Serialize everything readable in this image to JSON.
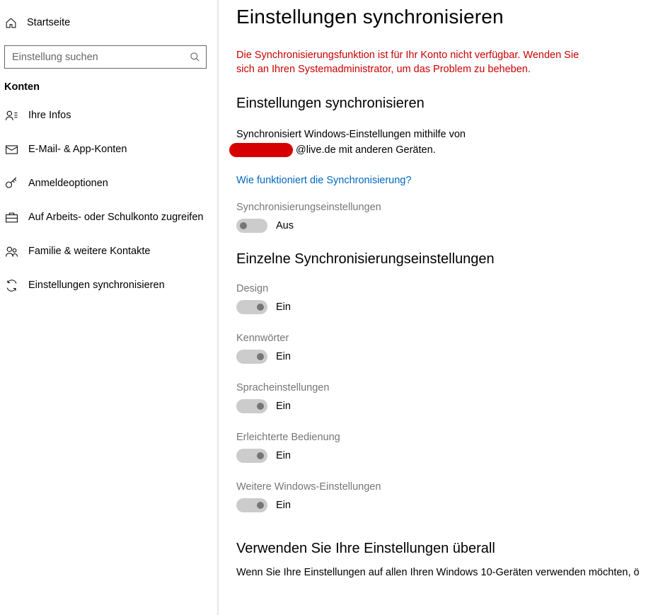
{
  "sidebar": {
    "home_label": "Startseite",
    "search_placeholder": "Einstellung suchen",
    "category_label": "Konten",
    "items": [
      {
        "label": "Ihre Infos"
      },
      {
        "label": "E-Mail- & App-Konten"
      },
      {
        "label": "Anmeldeoptionen"
      },
      {
        "label": "Auf Arbeits- oder Schulkonto zugreifen"
      },
      {
        "label": "Familie & weitere Kontakte"
      },
      {
        "label": "Einstellungen synchronisieren"
      }
    ]
  },
  "main": {
    "title": "Einstellungen synchronisieren",
    "error": "Die Synchronisierungsfunktion ist für Ihr Konto nicht verfügbar. Wenden Sie sich an Ihren Systemadministrator, um das Problem zu beheben.",
    "section1_heading": "Einstellungen synchronisieren",
    "desc_line1": "Synchronisiert Windows-Einstellungen mithilfe von",
    "desc_line2_suffix": "@live.de mit anderen Geräten.",
    "help_link": "Wie funktioniert die Synchronisierung?",
    "master_toggle": {
      "label": "Synchronisierungseinstellungen",
      "status": "Aus"
    },
    "section2_heading": "Einzelne Synchronisierungseinstellungen",
    "toggles": [
      {
        "label": "Design",
        "status": "Ein"
      },
      {
        "label": "Kennwörter",
        "status": "Ein"
      },
      {
        "label": "Spracheinstellungen",
        "status": "Ein"
      },
      {
        "label": "Erleichterte Bedienung",
        "status": "Ein"
      },
      {
        "label": "Weitere Windows-Einstellungen",
        "status": "Ein"
      }
    ],
    "section3_heading": "Verwenden Sie Ihre Einstellungen überall",
    "section3_text": "Wenn Sie Ihre Einstellungen auf allen Ihren Windows 10-Geräten verwenden möchten, ö"
  }
}
